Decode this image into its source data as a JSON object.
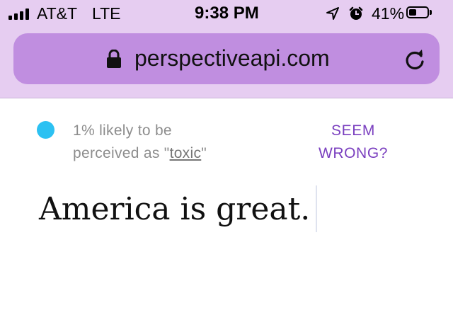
{
  "status_bar": {
    "carrier": "AT&T",
    "network": "LTE",
    "time": "9:38 PM",
    "battery_percent": "41%",
    "battery_level": 0.41
  },
  "browser": {
    "url": "perspectiveapi.com"
  },
  "result": {
    "indicator_color": "#2cc1f2",
    "line1": "1% likely to be",
    "line2_prefix": "perceived as \"",
    "line2_term": "toxic",
    "line2_suffix": "\"",
    "feedback_line1": "SEEM",
    "feedback_line2": "WRONG?"
  },
  "editor": {
    "text": "America is great."
  }
}
